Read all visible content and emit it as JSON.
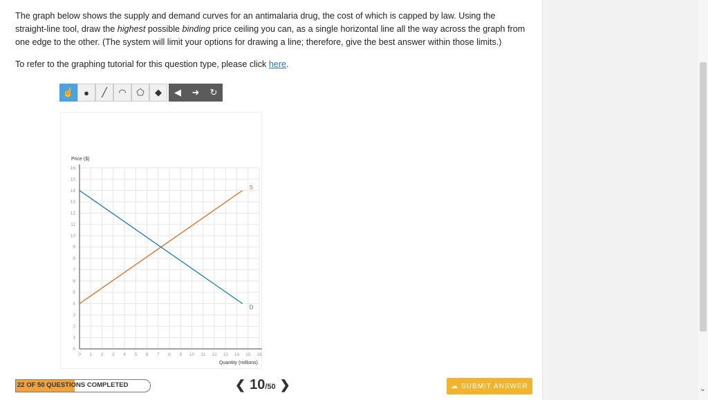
{
  "question": {
    "p1": "The graph below shows the supply and demand curves for an antimalaria drug, the cost of which is capped by law. Using the straight-line tool, draw the ",
    "em1": "highest",
    "p2": " possible ",
    "em2": "binding",
    "p3": " price ceiling you can, as a single horizontal line all the way across the graph from one edge to the other. (The system will limit your options for drawing a line; therefore, give the best answer within those limits.)",
    "refer_text": "To refer to the graphing tutorial for this question type, please click ",
    "refer_link": "here",
    "refer_end": "."
  },
  "toolbar": {
    "tools": [
      {
        "icon": "hand-pointer-icon",
        "glyph": "☝"
      },
      {
        "icon": "point-icon",
        "glyph": "●"
      },
      {
        "icon": "line-icon",
        "glyph": "╱"
      },
      {
        "icon": "curve-icon",
        "glyph": "◠"
      },
      {
        "icon": "polygon-icon",
        "glyph": "⬠"
      },
      {
        "icon": "label-tag-icon",
        "glyph": "◆"
      }
    ],
    "actions": [
      {
        "icon": "undo-icon",
        "glyph": "◀"
      },
      {
        "icon": "redo-icon",
        "glyph": "➜"
      },
      {
        "icon": "reset-icon",
        "glyph": "↻"
      }
    ]
  },
  "chart_data": {
    "type": "line",
    "ylabel": "Price ($)",
    "xlabel": "Quantity (millions)",
    "xlim": [
      0,
      16
    ],
    "ylim": [
      0,
      16
    ],
    "x_ticks": [
      "0",
      "1",
      "2",
      "3",
      "4",
      "5",
      "6",
      "7",
      "8",
      "9",
      "10",
      "11",
      "12",
      "13",
      "14",
      "15",
      "16"
    ],
    "y_ticks": [
      "0",
      "1",
      "2",
      "3",
      "4",
      "5",
      "6",
      "7",
      "8",
      "9",
      "10",
      "11",
      "12",
      "13",
      "14",
      "15",
      "16"
    ],
    "grid": true,
    "series": [
      {
        "name": "S",
        "color": "#e06a1e",
        "points": [
          [
            0,
            4
          ],
          [
            14.5,
            14
          ]
        ]
      },
      {
        "name": "D",
        "color": "#1c7cb0",
        "points": [
          [
            0,
            14
          ],
          [
            14.5,
            4
          ]
        ]
      }
    ]
  },
  "footer": {
    "progress_label": "22 OF 50 QUESTIONS COMPLETED",
    "progress_fraction": 0.44,
    "page_current": "10",
    "page_total": "/50",
    "prev_glyph": "❮",
    "next_glyph": "❯",
    "submit_label": "SUBMIT ANSWER",
    "submit_icon": "☁"
  }
}
